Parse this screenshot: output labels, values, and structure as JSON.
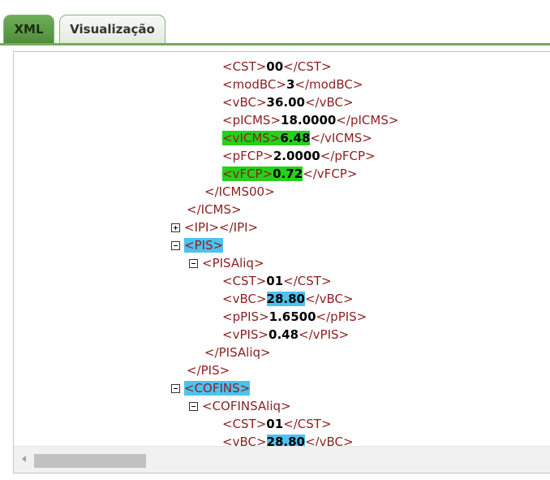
{
  "tabs": {
    "xml": "XML",
    "visualizacao": "Visualização"
  },
  "lines": {
    "cst1": [
      "<CST>",
      "00",
      "</CST>"
    ],
    "modbc": [
      "<modBC>",
      "3",
      "</modBC>"
    ],
    "vbc1": [
      "<vBC>",
      "36.00",
      "</vBC>"
    ],
    "picms": [
      "<pICMS>",
      "18.0000",
      "</pICMS>"
    ],
    "vicms": [
      "<vICMS>",
      "6.48",
      "</vICMS>"
    ],
    "pfcp": [
      "<pFCP>",
      "2.0000",
      "</pFCP>"
    ],
    "vfcp": [
      "<vFCP>",
      "0.72",
      "</vFCP>"
    ],
    "icms00_close": "</ICMS00>",
    "icms_close": "</ICMS>",
    "ipi": "<IPI></IPI>",
    "pis_open": "<PIS>",
    "pisaliq_open": "<PISAliq>",
    "cst2": [
      "<CST>",
      "01",
      "</CST>"
    ],
    "vbc2": [
      "<vBC>",
      "28.80",
      "</vBC>"
    ],
    "ppis": [
      "<pPIS>",
      "1.6500",
      "</pPIS>"
    ],
    "vpis": [
      "<vPIS>",
      "0.48",
      "</vPIS>"
    ],
    "pisaliq_close": "</PISAliq>",
    "pis_close": "</PIS>",
    "cofins_open": "<COFINS>",
    "cofinsaliq_open": "<COFINSAliq>",
    "cst3": [
      "<CST>",
      "01",
      "</CST>"
    ],
    "vbc3": [
      "<vBC>",
      "28.80",
      "</vBC>"
    ]
  },
  "highlight_colors": {
    "green": "#25d119",
    "blue": "#4cc3ef"
  }
}
